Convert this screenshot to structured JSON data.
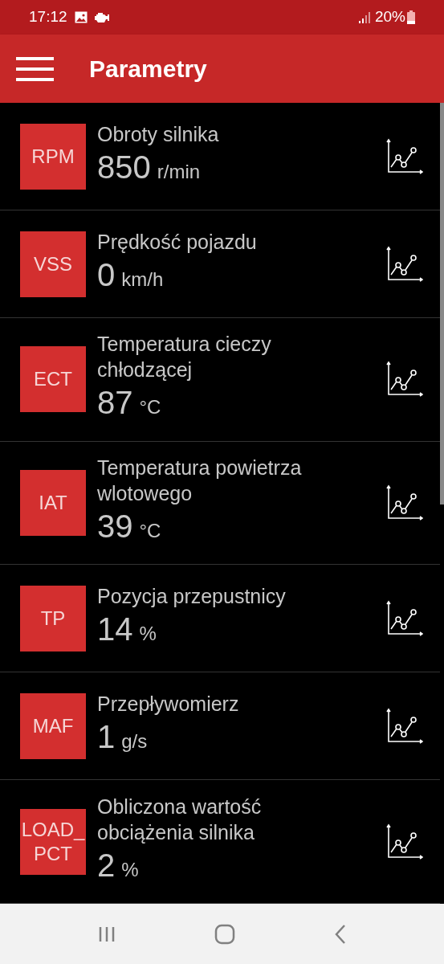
{
  "status_bar": {
    "time": "17:12",
    "battery": "20%"
  },
  "app_bar": {
    "title": "Parametry"
  },
  "parameters": [
    {
      "code": "RPM",
      "name": "Obroty silnika",
      "value": "850",
      "unit": "r/min"
    },
    {
      "code": "VSS",
      "name": "Prędkość pojazdu",
      "value": "0",
      "unit": "km/h"
    },
    {
      "code": "ECT",
      "name": "Temperatura cieczy chłodzącej",
      "value": "87",
      "unit": "°C"
    },
    {
      "code": "IAT",
      "name": "Temperatura powietrza wlotowego",
      "value": "39",
      "unit": "°C"
    },
    {
      "code": "TP",
      "name": "Pozycja przepustnicy",
      "value": "14",
      "unit": "%"
    },
    {
      "code": "MAF",
      "name": "Przepływomierz",
      "value": "1",
      "unit": "g/s"
    },
    {
      "code": "LOAD_PCT",
      "name": "Obliczona wartość obciążenia silnika",
      "value": "2",
      "unit": "%"
    }
  ]
}
